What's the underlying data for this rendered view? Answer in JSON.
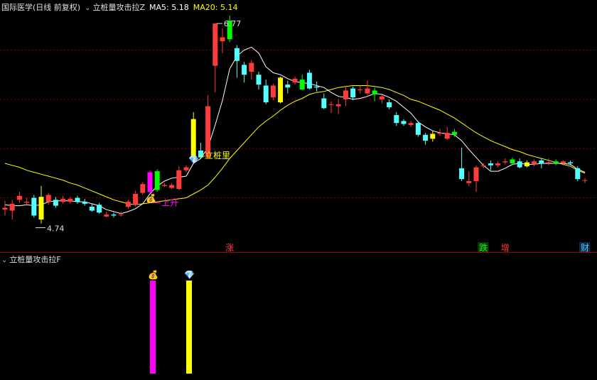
{
  "header": {
    "stock": "国际医学(日线 前复权)",
    "indicator": "立桩量攻击拉Z",
    "ma5_label": "MA5: 5.18",
    "ma20_label": "MA20: 5.14",
    "colors": {
      "stock": "#e0e0e0",
      "indicator": "#e0e0e0",
      "ma5": "#ffffff",
      "ma20": "#ffff00"
    }
  },
  "sub_header": {
    "indicator": "立桩量攻击拉F"
  },
  "annotations": {
    "high_label": "6.77",
    "low_label": "4.74",
    "signal_rise": "上升",
    "signal_pile": "立桩里",
    "events": [
      "涨",
      "跌",
      "增",
      "财"
    ]
  },
  "colors": {
    "up": "#ff3b3b",
    "down": "#54ffff",
    "limit_up": "#ffff00",
    "limit_down": "#00ff00",
    "ma20": "#ffff00",
    "ma5": "#ffffff",
    "signal_magenta": "#ff00ff",
    "signal_yellow": "#ffff00",
    "grid": "#8b0000",
    "divider": "#a00000"
  },
  "chart_data": {
    "type": "candlestick",
    "price_range": [
      4.6,
      6.85
    ],
    "candles": [
      {
        "o": 4.88,
        "c": 4.9,
        "h": 4.97,
        "l": 4.82,
        "up": true
      },
      {
        "o": 4.87,
        "c": 4.94,
        "h": 4.98,
        "l": 4.78,
        "up": true
      },
      {
        "o": 5.02,
        "c": 4.98,
        "h": 5.06,
        "l": 4.95,
        "up": true
      },
      {
        "o": 4.95,
        "c": 4.96,
        "h": 5.0,
        "l": 4.92,
        "up": true
      },
      {
        "o": 5.0,
        "c": 4.82,
        "h": 5.03,
        "l": 4.8,
        "up": false
      },
      {
        "o": 4.78,
        "c": 5.01,
        "h": 5.12,
        "l": 4.74,
        "up": true,
        "color": "#ffff00"
      },
      {
        "o": 4.96,
        "c": 5.03,
        "h": 5.05,
        "l": 4.93,
        "up": true
      },
      {
        "o": 4.98,
        "c": 4.92,
        "h": 5.01,
        "l": 4.9,
        "up": false
      },
      {
        "o": 4.96,
        "c": 4.99,
        "h": 5.02,
        "l": 4.94,
        "up": true
      },
      {
        "o": 4.96,
        "c": 4.99,
        "h": 5.01,
        "l": 4.94,
        "up": true
      },
      {
        "o": 5.0,
        "c": 4.96,
        "h": 5.02,
        "l": 4.94,
        "up": false
      },
      {
        "o": 4.96,
        "c": 4.94,
        "h": 4.99,
        "l": 4.92,
        "up": false
      },
      {
        "o": 4.91,
        "c": 4.87,
        "h": 4.94,
        "l": 4.86,
        "up": false
      },
      {
        "o": 4.93,
        "c": 4.85,
        "h": 4.95,
        "l": 4.84,
        "up": false
      },
      {
        "o": 4.83,
        "c": 4.81,
        "h": 4.86,
        "l": 4.8,
        "up": true
      },
      {
        "o": 4.83,
        "c": 4.82,
        "h": 4.85,
        "l": 4.8,
        "up": false
      },
      {
        "o": 4.83,
        "c": 4.83,
        "h": 4.86,
        "l": 4.81,
        "up": true
      },
      {
        "o": 4.91,
        "c": 4.96,
        "h": 4.98,
        "l": 4.89,
        "up": true
      },
      {
        "o": 4.93,
        "c": 5.04,
        "h": 5.07,
        "l": 4.91,
        "up": true
      },
      {
        "o": 5.05,
        "c": 5.14,
        "h": 5.16,
        "l": 5.03,
        "up": true
      },
      {
        "o": 5.06,
        "c": 5.26,
        "h": 5.28,
        "l": 5.05,
        "up": true,
        "color": "#ff00ff"
      },
      {
        "o": 5.08,
        "c": 5.27,
        "h": 5.29,
        "l": 5.06,
        "up": true,
        "color": "#00ff00"
      },
      {
        "o": 5.12,
        "c": 5.13,
        "h": 5.15,
        "l": 5.11,
        "up": true
      },
      {
        "o": 5.1,
        "c": 5.13,
        "h": 5.15,
        "l": 5.09,
        "up": true
      },
      {
        "o": 5.09,
        "c": 5.28,
        "h": 5.32,
        "l": 5.08,
        "up": true
      },
      {
        "o": 5.28,
        "c": 5.31,
        "h": 5.33,
        "l": 5.26,
        "up": true
      },
      {
        "o": 5.41,
        "c": 5.8,
        "h": 5.87,
        "l": 5.38,
        "up": true,
        "color": "#ffff00"
      },
      {
        "o": 5.48,
        "c": 5.41,
        "h": 5.56,
        "l": 5.4,
        "up": false
      },
      {
        "o": 5.41,
        "c": 5.93,
        "h": 6.04,
        "l": 5.4,
        "up": true
      },
      {
        "o": 6.34,
        "c": 6.77,
        "h": 6.77,
        "l": 6.07,
        "up": true
      },
      {
        "o": 6.63,
        "c": 6.59,
        "h": 6.72,
        "l": 6.47,
        "up": true
      },
      {
        "o": 6.8,
        "c": 6.61,
        "h": 6.85,
        "l": 6.58,
        "up": true,
        "color": "#00ff00"
      },
      {
        "o": 6.52,
        "c": 6.39,
        "h": 6.55,
        "l": 6.22,
        "up": false
      },
      {
        "o": 6.35,
        "c": 6.25,
        "h": 6.38,
        "l": 6.17,
        "up": false
      },
      {
        "o": 6.37,
        "c": 6.28,
        "h": 6.4,
        "l": 6.2,
        "up": true
      },
      {
        "o": 6.25,
        "c": 6.15,
        "h": 6.28,
        "l": 6.1,
        "up": false
      },
      {
        "o": 6.14,
        "c": 5.97,
        "h": 6.2,
        "l": 5.95,
        "up": false
      },
      {
        "o": 6.02,
        "c": 6.14,
        "h": 6.16,
        "l": 5.99,
        "up": true
      },
      {
        "o": 5.97,
        "c": 6.22,
        "h": 6.23,
        "l": 5.96,
        "up": true,
        "color": "#ffff00"
      },
      {
        "o": 6.15,
        "c": 6.12,
        "h": 6.19,
        "l": 6.06,
        "up": false
      },
      {
        "o": 6.17,
        "c": 6.21,
        "h": 6.23,
        "l": 6.15,
        "up": true
      },
      {
        "o": 6.2,
        "c": 6.1,
        "h": 6.25,
        "l": 6.09,
        "up": false,
        "color": "#00ff00"
      },
      {
        "o": 6.27,
        "c": 6.11,
        "h": 6.3,
        "l": 6.1,
        "up": false
      },
      {
        "o": 6.12,
        "c": 6.13,
        "h": 6.18,
        "l": 6.08,
        "up": false
      },
      {
        "o": 6.01,
        "c": 5.91,
        "h": 6.06,
        "l": 5.9,
        "up": false
      },
      {
        "o": 5.95,
        "c": 5.95,
        "h": 5.98,
        "l": 5.86,
        "up": true
      },
      {
        "o": 5.93,
        "c": 5.95,
        "h": 6.0,
        "l": 5.85,
        "up": true
      },
      {
        "o": 6.0,
        "c": 6.09,
        "h": 6.14,
        "l": 5.93,
        "up": true
      },
      {
        "o": 6.11,
        "c": 6.02,
        "h": 6.13,
        "l": 5.99,
        "up": false
      },
      {
        "o": 6.1,
        "c": 6.1,
        "h": 6.14,
        "l": 6.06,
        "up": true
      },
      {
        "o": 6.06,
        "c": 6.11,
        "h": 6.19,
        "l": 6.04,
        "up": true
      },
      {
        "o": 6.05,
        "c": 6.09,
        "h": 6.12,
        "l": 5.98,
        "up": false,
        "color": "#00ff00"
      },
      {
        "o": 6.03,
        "c": 6.0,
        "h": 6.05,
        "l": 5.96,
        "up": true
      },
      {
        "o": 5.97,
        "c": 5.92,
        "h": 6.0,
        "l": 5.9,
        "up": false
      },
      {
        "o": 5.84,
        "c": 5.76,
        "h": 5.87,
        "l": 5.73,
        "up": false
      },
      {
        "o": 5.78,
        "c": 5.75,
        "h": 5.8,
        "l": 5.73,
        "up": false
      },
      {
        "o": 5.76,
        "c": 5.74,
        "h": 5.78,
        "l": 5.72,
        "up": true
      },
      {
        "o": 5.76,
        "c": 5.64,
        "h": 5.78,
        "l": 5.62,
        "up": false
      },
      {
        "o": 5.64,
        "c": 5.58,
        "h": 5.66,
        "l": 5.54,
        "up": false
      },
      {
        "o": 5.6,
        "c": 5.65,
        "h": 5.68,
        "l": 5.57,
        "up": false,
        "color": "#ffff00"
      },
      {
        "o": 5.66,
        "c": 5.65,
        "h": 5.7,
        "l": 5.63,
        "up": true
      },
      {
        "o": 5.66,
        "c": 5.6,
        "h": 5.72,
        "l": 5.59,
        "up": true
      },
      {
        "o": 5.64,
        "c": 5.67,
        "h": 5.7,
        "l": 5.62,
        "up": false,
        "color": "#00ff00"
      },
      {
        "o": 5.3,
        "c": 5.19,
        "h": 5.51,
        "l": 5.17,
        "up": false
      },
      {
        "o": 5.17,
        "c": 5.15,
        "h": 5.27,
        "l": 5.12,
        "up": true
      },
      {
        "o": 5.31,
        "c": 5.17,
        "h": 5.33,
        "l": 5.06,
        "up": true
      },
      {
        "o": 5.32,
        "c": 5.33,
        "h": 5.35,
        "l": 5.3,
        "up": true
      },
      {
        "o": 5.35,
        "c": 5.33,
        "h": 5.38,
        "l": 5.28,
        "up": false
      },
      {
        "o": 5.33,
        "c": 5.35,
        "h": 5.37,
        "l": 5.31,
        "up": true
      },
      {
        "o": 5.36,
        "c": 5.37,
        "h": 5.4,
        "l": 5.34,
        "up": true
      },
      {
        "o": 5.39,
        "c": 5.35,
        "h": 5.41,
        "l": 5.34,
        "up": false,
        "color": "#00ff00"
      },
      {
        "o": 5.37,
        "c": 5.31,
        "h": 5.4,
        "l": 5.3,
        "up": false
      },
      {
        "o": 5.36,
        "c": 5.32,
        "h": 5.38,
        "l": 5.31,
        "up": true,
        "color": "#ffff00"
      },
      {
        "o": 5.34,
        "c": 5.37,
        "h": 5.39,
        "l": 5.32,
        "up": true
      },
      {
        "o": 5.38,
        "c": 5.35,
        "h": 5.4,
        "l": 5.3,
        "up": false
      },
      {
        "o": 5.36,
        "c": 5.36,
        "h": 5.4,
        "l": 5.33,
        "up": true
      },
      {
        "o": 5.37,
        "c": 5.35,
        "h": 5.39,
        "l": 5.33,
        "up": false,
        "color": "#00ff00"
      },
      {
        "o": 5.35,
        "c": 5.37,
        "h": 5.38,
        "l": 5.33,
        "up": true
      },
      {
        "o": 5.36,
        "c": 5.35,
        "h": 5.38,
        "l": 5.33,
        "up": false
      },
      {
        "o": 5.3,
        "c": 5.19,
        "h": 5.32,
        "l": 5.17,
        "up": false
      },
      {
        "o": 5.18,
        "c": 5.18,
        "h": 5.2,
        "l": 5.15,
        "up": true
      }
    ],
    "ma5": [
      4.93,
      4.92,
      4.92,
      4.93,
      4.92,
      4.93,
      4.96,
      4.97,
      4.97,
      4.97,
      4.96,
      4.96,
      4.94,
      4.92,
      4.88,
      4.86,
      4.84,
      4.86,
      4.89,
      4.94,
      5.04,
      5.12,
      5.17,
      5.2,
      5.21,
      5.22,
      5.35,
      5.4,
      5.51,
      5.74,
      5.99,
      6.31,
      6.44,
      6.5,
      6.53,
      6.47,
      6.33,
      6.27,
      6.25,
      6.21,
      6.18,
      6.17,
      6.16,
      6.14,
      6.12,
      6.07,
      6.03,
      6.02,
      6.0,
      6.01,
      6.03,
      6.06,
      6.05,
      6.02,
      5.98,
      5.92,
      5.86,
      5.77,
      5.72,
      5.68,
      5.66,
      5.65,
      5.64,
      5.58,
      5.49,
      5.41,
      5.33,
      5.27,
      5.27,
      5.3,
      5.34,
      5.35,
      5.34,
      5.34,
      5.35,
      5.35,
      5.35,
      5.35,
      5.34,
      5.29,
      5.26
    ],
    "ma20": [
      5.35,
      5.33,
      5.31,
      5.28,
      5.26,
      5.24,
      5.22,
      5.2,
      5.18,
      5.15,
      5.13,
      5.1,
      5.07,
      5.04,
      5.01,
      4.98,
      4.96,
      4.94,
      4.93,
      4.94,
      4.95,
      4.96,
      4.97,
      4.98,
      4.99,
      5.0,
      5.04,
      5.08,
      5.13,
      5.21,
      5.3,
      5.4,
      5.48,
      5.56,
      5.64,
      5.72,
      5.78,
      5.83,
      5.89,
      5.94,
      5.98,
      6.01,
      6.05,
      6.07,
      6.08,
      6.1,
      6.12,
      6.13,
      6.14,
      6.14,
      6.14,
      6.13,
      6.12,
      6.1,
      6.07,
      6.04,
      6.0,
      5.98,
      5.95,
      5.92,
      5.89,
      5.85,
      5.81,
      5.76,
      5.71,
      5.66,
      5.62,
      5.58,
      5.55,
      5.52,
      5.49,
      5.47,
      5.44,
      5.42,
      5.4,
      5.38,
      5.36,
      5.34,
      5.32,
      5.28,
      5.25
    ],
    "signals": [
      {
        "index": 20,
        "color": "#ff00ff"
      },
      {
        "index": 25,
        "color": "#ffff00"
      }
    ]
  }
}
